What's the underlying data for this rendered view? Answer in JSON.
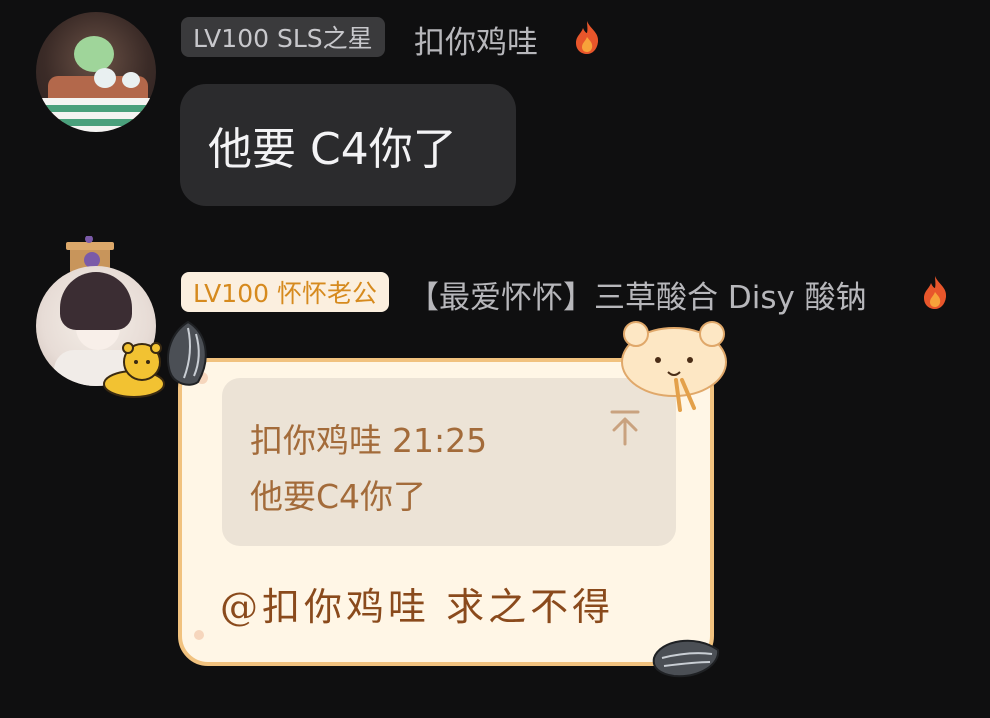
{
  "messages": [
    {
      "badge": "LV100 SLS之星",
      "username": "扣你鸡哇",
      "text": "他要 C4你了",
      "badge_style": "gray",
      "avatar_icon": "avatar-icecream-icon",
      "fire_icon": "fire-icon"
    },
    {
      "badge": "LV100 怀怀老公",
      "username": "【最爱怀怀】三草酸合 Disy 酸钠",
      "badge_style": "gold",
      "avatar_icon": "avatar-anime-boy-icon",
      "fire_icon": "fire-icon",
      "quote": {
        "author": "扣你鸡哇",
        "time": "21:25",
        "text": "他要C4你了"
      },
      "reply": "@扣你鸡哇 求之不得"
    }
  ],
  "colors": {
    "background": "#0f0f10",
    "bubble": "#2b2b2d",
    "gray_badge": "#3a3a3c",
    "gold_badge": "#fbefdf",
    "gold_text": "#d68a1e",
    "card_bg": "#fff6e6",
    "card_border": "#f1c27f",
    "quote_bg": "#ece3d6",
    "quote_text": "#a36b3a",
    "reply_text": "#8a4a1c"
  }
}
